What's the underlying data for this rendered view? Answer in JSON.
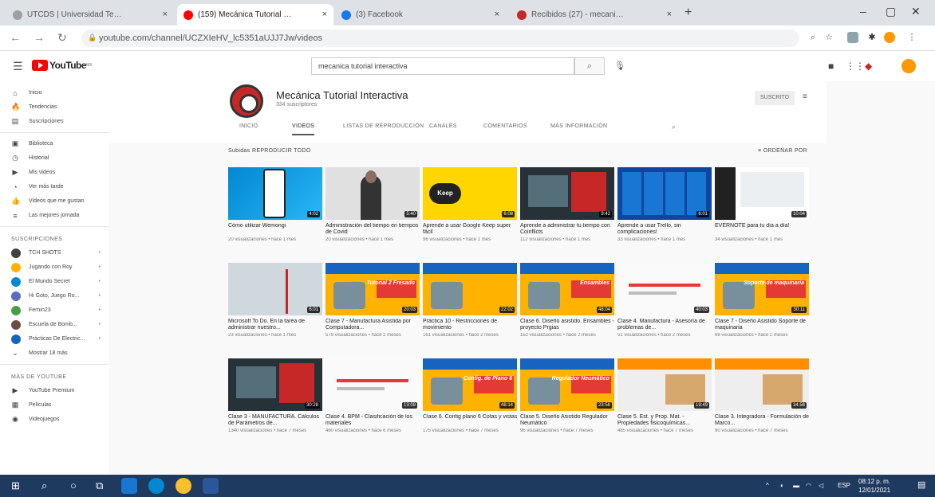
{
  "browser": {
    "tabs": [
      {
        "label": "UTCDS | Universidad Tecnológi...",
        "favicon_color": "#9e9e9e",
        "active": false
      },
      {
        "label": "(159) Mecánica Tutorial Interacti...",
        "favicon_color": "#ff0000",
        "active": true
      },
      {
        "label": "(3) Facebook",
        "favicon_color": "#1877f2",
        "active": false
      },
      {
        "label": "Recibidos (27) - mecanica@utcd...",
        "favicon_color": "#c62828",
        "active": false
      }
    ],
    "new_tab": "+",
    "url": "youtube.com/channel/UCZXIeHV_lc5351aUJJ7Jw/videos",
    "window_controls": [
      "–",
      "▢",
      "✕"
    ]
  },
  "youtube": {
    "logo_text": "YouTube",
    "logo_sup": "MX",
    "search_value": "mecanica tutorial interactiva",
    "sidebar": {
      "main": [
        {
          "icon": "home-icon",
          "glyph": "⌂",
          "label": "Inicio"
        },
        {
          "icon": "trending-icon",
          "glyph": "🔥",
          "label": "Tendencias"
        },
        {
          "icon": "subscriptions-icon",
          "glyph": "▤",
          "label": "Suscripciones"
        }
      ],
      "library": [
        {
          "icon": "library-icon",
          "glyph": "▣",
          "label": "Biblioteca"
        },
        {
          "icon": "history-icon",
          "glyph": "◷",
          "label": "Historial"
        },
        {
          "icon": "your-videos-icon",
          "glyph": "▶",
          "label": "Mis videos"
        },
        {
          "icon": "watch-later-icon",
          "glyph": "◔",
          "label": "Ver más tarde"
        },
        {
          "icon": "liked-icon",
          "glyph": "👍",
          "label": "Videos que me gustan"
        },
        {
          "icon": "playlist-icon",
          "glyph": "≡",
          "label": "Las mejores jornada"
        }
      ],
      "subscriptions_heading": "SUSCRIPCIONES",
      "subscriptions": [
        {
          "label": "TCH SHOTS",
          "color": "#424242"
        },
        {
          "label": "Jugando con Roy",
          "color": "#ffb300"
        },
        {
          "label": "El Mundo Secret",
          "color": "#0288d1"
        },
        {
          "label": "Hi Goto, Juego Ro...",
          "color": "#5c6bc0"
        },
        {
          "label": "Fernin23",
          "color": "#43a047"
        },
        {
          "label": "Escuela de Bomb...",
          "color": "#6d4c41"
        },
        {
          "label": "Prácticas De Electric...",
          "color": "#1565c0"
        }
      ],
      "show_more": "Mostrar 18 más",
      "more_heading": "MÁS DE YOUTUBE",
      "more": [
        {
          "icon": "premium-icon",
          "glyph": "▶",
          "label": "YouTube Premium"
        },
        {
          "icon": "movies-icon",
          "glyph": "▦",
          "label": "Películas"
        },
        {
          "icon": "gaming-icon",
          "glyph": "◉",
          "label": "Videojuegos"
        }
      ]
    },
    "channel": {
      "name": "Mecánica Tutorial Interactiva",
      "subscribers": "334 suscriptores",
      "customize_label": "SUSCRITO",
      "tabs": [
        {
          "label": "INICIO",
          "active": false
        },
        {
          "label": "VIDEOS",
          "active": true
        },
        {
          "label": "LISTAS DE REPRODUCCIÓN",
          "active": false
        },
        {
          "label": "CANALES",
          "active": false
        },
        {
          "label": "COMENTARIOS",
          "active": false
        },
        {
          "label": "MÁS INFORMACIÓN",
          "active": false
        }
      ],
      "section_title": "Subidas",
      "play_all": "REPRODUCIR TODO",
      "sort_label": "ORDENAR POR"
    },
    "videos": [
      {
        "title": "Cómo utilizar Wemongi",
        "meta": "20 visualizaciones • hace 1 mes",
        "duration": "4:02",
        "style": "t-blue"
      },
      {
        "title": "Administración del tiempo en tiempos de Covid",
        "meta": "20 visualizaciones • hace 1 mes",
        "duration": "5:40",
        "style": "t-person"
      },
      {
        "title": "Aprende a usar Google Keep super fácil",
        "meta": "96 visualizaciones • hace 1 mes",
        "duration": "6:08",
        "style": "t-keep",
        "badge": "Keep"
      },
      {
        "title": "Aprende a administrar tu tiempo con Coinflicts",
        "meta": "112 visualizaciones • hace 1 mes",
        "duration": "9:42",
        "style": "t-dark"
      },
      {
        "title": "Aprende a usar Trello, sin complicaciones!",
        "meta": "33 visualizaciones • hace 1 mes",
        "duration": "6:01",
        "style": "t-trello"
      },
      {
        "title": "EVERNOTE para tu día a día!",
        "meta": "34 visualizaciones • hace 1 mes",
        "duration": "10:04",
        "style": "t-ever"
      },
      {
        "title": "Microsoft To Do. En la tarea de administrar nuestro...",
        "meta": "23 visualizaciones • hace 1 mes",
        "duration": "6:01",
        "style": "t-gray"
      },
      {
        "title": "Clase 7 - Manufactura Asistida por Computadora...",
        "meta": "579 visualizaciones • hace 2 meses",
        "duration": "20:03",
        "style": "t-yellow",
        "label": "Tutorial 2 Fresado"
      },
      {
        "title": "Práctica 10 - Restricciones de movimiento",
        "meta": "161 visualizaciones • hace 2 meses",
        "duration": "22:02",
        "style": "t-yellow"
      },
      {
        "title": "Clase 6. Diseño asistido. Ensambles - proyecto Prgias",
        "meta": "152 visualizaciones • hace 2 meses",
        "duration": "48:04",
        "style": "t-yellow",
        "label": "Ensambles"
      },
      {
        "title": "Clase 4. Manufactura - Asesoría de problemas de...",
        "meta": "51 visualizaciones • hace 2 meses",
        "duration": "40:03",
        "style": "t-white"
      },
      {
        "title": "Clase 7 - Diseño Asistido Soporte de maquinaria",
        "meta": "98 visualizaciones • hace 2 meses",
        "duration": "30:11",
        "style": "t-yellow",
        "label": "Soporte de maquinaria"
      },
      {
        "title": "Clase 3 - MANUFACTURA. Cálculos de Parámetros de...",
        "meta": "1340 visualizaciones • hace 7 meses",
        "duration": "30:28",
        "style": "t-dark"
      },
      {
        "title": "Clase 4. BPM - Clasificación de los materiales",
        "meta": "460 visualizaciones • hace 6 meses",
        "duration": "13:09",
        "style": "t-white"
      },
      {
        "title": "Clase 6. Config plano 6 Cotas y vistas",
        "meta": "175 visualizaciones • hace 7 meses",
        "duration": "48:14",
        "style": "t-yellow",
        "label": "Config. de Plano 6"
      },
      {
        "title": "Clase 5. Diseño Asistido Regulador Neumático",
        "meta": "96 visualizaciones • hace 7 meses",
        "duration": "23:58",
        "style": "t-yellow",
        "label": "Regulador Neumático"
      },
      {
        "title": "Clase 5. Est. y Prop. Mat. - Propiedades fisicoquímicas...",
        "meta": "485 visualizaciones • hace 7 meses",
        "duration": "19:49",
        "style": "t-slide"
      },
      {
        "title": "Clase 3. Integradora - Formulación de Marco...",
        "meta": "90 visualizaciones • hace 7 meses",
        "duration": "34:56",
        "style": "t-slide"
      }
    ]
  },
  "taskbar": {
    "time": "08:12 p. m.",
    "date": "12/01/2021",
    "lang": "ESP"
  }
}
